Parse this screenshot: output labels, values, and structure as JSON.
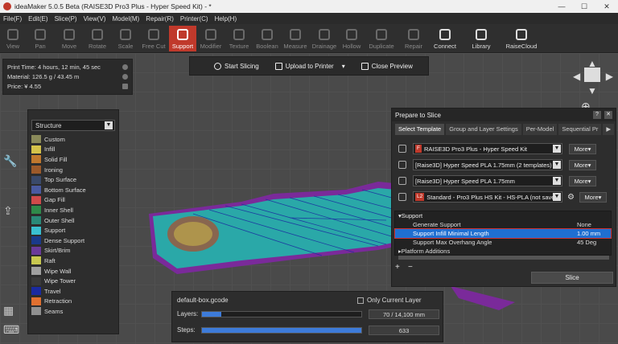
{
  "window": {
    "title": "ideaMaker 5.0.5 Beta (RAISE3D Pro3 Plus - Hyper Speed Kit) - *",
    "controls": [
      "—",
      "☐",
      "✕"
    ]
  },
  "menu": [
    "File(F)",
    "Edit(E)",
    "Slice(P)",
    "View(V)",
    "Model(M)",
    "Repair(R)",
    "Printer(C)",
    "Help(H)"
  ],
  "toolbar": [
    {
      "label": "View",
      "state": "disabled"
    },
    {
      "label": "Pan",
      "state": "disabled"
    },
    {
      "label": "Move",
      "state": "disabled"
    },
    {
      "label": "Rotate",
      "state": "disabled"
    },
    {
      "label": "Scale",
      "state": "disabled"
    },
    {
      "label": "Free Cut",
      "state": "disabled"
    },
    {
      "label": "Support",
      "state": "active"
    },
    {
      "label": "Modifier",
      "state": "disabled"
    },
    {
      "label": "Texture",
      "state": "disabled"
    },
    {
      "label": "Boolean",
      "state": "disabled"
    },
    {
      "label": "Measure",
      "state": "disabled"
    },
    {
      "label": "Drainage",
      "state": "disabled"
    },
    {
      "label": "Hollow",
      "state": "disabled"
    },
    {
      "label": "Duplicate",
      "state": "disabled"
    },
    {
      "label": "Repair",
      "state": "disabled"
    },
    {
      "label": "Connect",
      "state": "enabled"
    },
    {
      "label": "Library",
      "state": "enabled"
    },
    {
      "label": "RaiseCloud",
      "state": "enabled"
    }
  ],
  "print_info": {
    "time_label": "Print Time:",
    "time_value": "4 hours, 12 min, 45 sec",
    "material_label": "Material:",
    "material_value": "126.5 g / 43.45 m",
    "price_label": "Price:",
    "price_value": "¥ 4.55"
  },
  "actions": {
    "start": "Start Slicing",
    "upload": "Upload to Printer",
    "close": "Close Preview"
  },
  "structure": {
    "selected": "Structure",
    "items": [
      {
        "label": "Custom",
        "color": "#8a8a5a"
      },
      {
        "label": "Infill",
        "color": "#d4c24a"
      },
      {
        "label": "Solid Fill",
        "color": "#c0782e"
      },
      {
        "label": "Ironing",
        "color": "#9c5a2a"
      },
      {
        "label": "Top Surface",
        "color": "#3a4a6a"
      },
      {
        "label": "Bottom Surface",
        "color": "#4a5aa0"
      },
      {
        "label": "Gap Fill",
        "color": "#d04a4a"
      },
      {
        "label": "Inner Shell",
        "color": "#2f8a4a"
      },
      {
        "label": "Outer Shell",
        "color": "#2a8a78"
      },
      {
        "label": "Support",
        "color": "#3ac0d0"
      },
      {
        "label": "Dense Support",
        "color": "#1a3a8a"
      },
      {
        "label": "Skirt/Brim",
        "color": "#6a3a9a"
      },
      {
        "label": "Raft",
        "color": "#c8c850"
      },
      {
        "label": "Wipe Wall",
        "color": "#a0a0a0"
      },
      {
        "label": "Wipe Tower",
        "color": "#3a3a3a"
      },
      {
        "label": "Travel",
        "color": "#1a2aa0"
      },
      {
        "label": "Retraction",
        "color": "#e07030"
      },
      {
        "label": "Seams",
        "color": "#909090"
      }
    ]
  },
  "prepare": {
    "title": "Prepare to Slice",
    "tabs": [
      "Select Template",
      "Group and Layer Settings",
      "Per-Model",
      "Sequential Pr"
    ],
    "printer": {
      "value": "RAISE3D Pro3 Plus - Hyper Speed Kit",
      "badge": "F",
      "more": "More"
    },
    "filament1": {
      "value": "[Raise3D] Hyper Speed PLA 1.75mm (2 templates)",
      "more": "More"
    },
    "filament2": {
      "value": "[Raise3D] Hyper Speed PLA 1.75mm",
      "more": "More"
    },
    "template": {
      "value": "Standard - Pro3 Plus HS Kit - HS-PLA (not save",
      "badge": "L2",
      "more": "More"
    },
    "table": {
      "group": "Support",
      "rows": [
        {
          "name": "Generate Support",
          "value": "None",
          "highlight": false
        },
        {
          "name": "Support Infill Minimal Length",
          "value": "1.00 mm",
          "highlight": true
        },
        {
          "name": "Support Max Overhang Angle",
          "value": "45 Deg",
          "highlight": false
        }
      ],
      "next_group": "Platform Additions"
    },
    "slice": "Slice"
  },
  "gcode": {
    "file": "default-box.gcode",
    "only_current": "Only Current Layer",
    "layers_label": "Layers:",
    "layers_value": "70 / 14,100 mm",
    "layers_fraction": 0.12,
    "steps_label": "Steps:",
    "steps_value": "633",
    "steps_fraction": 1.0
  }
}
